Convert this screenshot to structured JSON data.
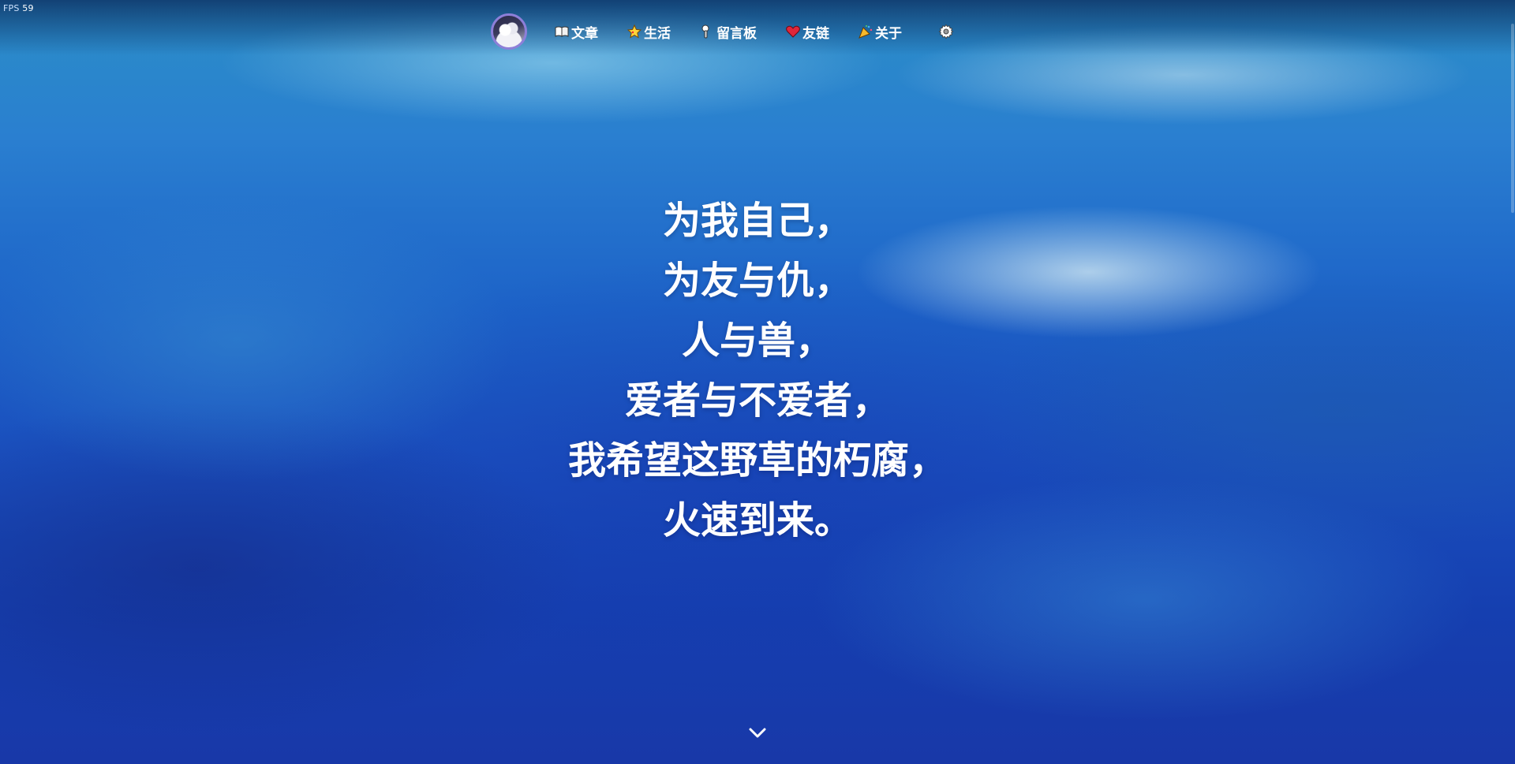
{
  "fps": {
    "label": "FPS",
    "value": "59"
  },
  "nav": {
    "avatar_alt": "avatar",
    "items": [
      {
        "label": "文章",
        "icon": "book-icon"
      },
      {
        "label": "生活",
        "icon": "star-icon"
      },
      {
        "label": "留言板",
        "icon": "microphone-icon"
      },
      {
        "label": "友链",
        "icon": "heart-icon"
      },
      {
        "label": "关于",
        "icon": "party-popper-icon"
      }
    ],
    "settings_icon": "gear-icon"
  },
  "poem": {
    "lines": [
      "为我自己，",
      "为友与仇，",
      "人与兽，",
      "爱者与不爱者，",
      "我希望这野草的朽腐，",
      "火速到来。"
    ]
  },
  "scroll_down_icon": "chevron-down-icon",
  "colors": {
    "text": "#ffffff",
    "avatar_border": "#8d7fd8",
    "background_top": "#2b8ec7",
    "background_bottom": "#1838a8"
  }
}
